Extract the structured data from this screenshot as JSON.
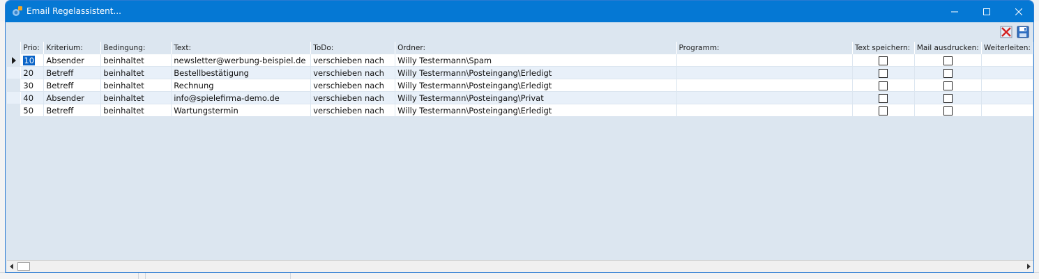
{
  "window": {
    "title": "Email Regelassistent..."
  },
  "toolbar": {
    "delete_icon": "delete-x-icon",
    "save_icon": "floppy-disk-icon"
  },
  "grid": {
    "columns": [
      "Prio:",
      "Kriterium:",
      "Bedingung:",
      "Text:",
      "ToDo:",
      "Ordner:",
      "Programm:",
      "Text speichern:",
      "Mail ausdrucken:",
      "Weiterleiten:"
    ],
    "rows": [
      {
        "prio": "10",
        "kriterium": "Absender",
        "bedingung": "beinhaltet",
        "text": "newsletter@werbung-beispiel.de",
        "todo": "verschieben nach",
        "ordner": "Willy Testermann\\Spam",
        "programm": "",
        "text_speichern": false,
        "mail_ausdrucken": false,
        "weiterleiten": ""
      },
      {
        "prio": "20",
        "kriterium": "Betreff",
        "bedingung": "beinhaltet",
        "text": "Bestellbestätigung",
        "todo": "verschieben nach",
        "ordner": "Willy Testermann\\Posteingang\\Erledigt",
        "programm": "",
        "text_speichern": false,
        "mail_ausdrucken": false,
        "weiterleiten": ""
      },
      {
        "prio": "30",
        "kriterium": "Betreff",
        "bedingung": "beinhaltet",
        "text": "Rechnung",
        "todo": "verschieben nach",
        "ordner": "Willy Testermann\\Posteingang\\Erledigt",
        "programm": "",
        "text_speichern": false,
        "mail_ausdrucken": false,
        "weiterleiten": ""
      },
      {
        "prio": "40",
        "kriterium": "Absender",
        "bedingung": "beinhaltet",
        "text": "info@spielefirma-demo.de",
        "todo": "verschieben nach",
        "ordner": "Willy Testermann\\Posteingang\\Privat",
        "programm": "",
        "text_speichern": false,
        "mail_ausdrucken": false,
        "weiterleiten": ""
      },
      {
        "prio": "50",
        "kriterium": "Betreff",
        "bedingung": "beinhaltet",
        "text": "Wartungstermin",
        "todo": "verschieben nach",
        "ordner": "Willy Testermann\\Posteingang\\Erledigt",
        "programm": "",
        "text_speichern": false,
        "mail_ausdrucken": false,
        "weiterleiten": ""
      }
    ]
  },
  "colors": {
    "titlebar": "#0578d4",
    "grid_bg": "#dce6f0",
    "row_alt": "#e8f0f9",
    "selection": "#0a64c8"
  }
}
